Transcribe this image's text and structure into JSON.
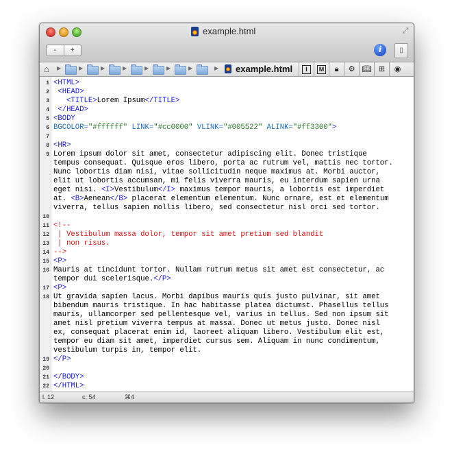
{
  "window": {
    "title": "example.html"
  },
  "toolbar": {
    "zoom_out": "-",
    "zoom_in": "+"
  },
  "pathbar": {
    "file": "example.html",
    "folders": 7
  },
  "tools": [
    "I",
    "M",
    "lock",
    "gear",
    "book",
    "grid",
    "circle"
  ],
  "code": [
    {
      "n": "1",
      "rows": [
        [
          [
            "tag",
            "<HTML>"
          ]
        ]
      ]
    },
    {
      "n": "2",
      "rows": [
        [
          [
            "txt",
            " "
          ],
          [
            "tag",
            "<HEAD>"
          ]
        ]
      ]
    },
    {
      "n": "3",
      "rows": [
        [
          [
            "txt",
            "   "
          ],
          [
            "tag",
            "<TITLE>"
          ],
          [
            "txt",
            "Lorem Ipsum"
          ],
          [
            "tag",
            "</TITLE>"
          ]
        ]
      ]
    },
    {
      "n": "4",
      "rows": [
        [
          [
            "txt",
            " "
          ],
          [
            "tag",
            "</HEAD>"
          ]
        ]
      ]
    },
    {
      "n": "5",
      "rows": [
        [
          [
            "tag",
            "<BODY"
          ]
        ]
      ]
    },
    {
      "n": "6",
      "rows": [
        [
          [
            "attr",
            "BGCOLOR="
          ],
          [
            "str",
            "\"#ffffff\""
          ],
          [
            "txt",
            " "
          ],
          [
            "attr",
            "LINK="
          ],
          [
            "str",
            "\"#cc0000\""
          ],
          [
            "txt",
            " "
          ],
          [
            "attr",
            "VLINK="
          ],
          [
            "str",
            "\"#005522\""
          ],
          [
            "txt",
            " "
          ],
          [
            "attr",
            "ALINK="
          ],
          [
            "str",
            "\"#ff3300\""
          ],
          [
            "tag",
            ">"
          ]
        ]
      ]
    },
    {
      "n": "7",
      "rows": [
        []
      ]
    },
    {
      "n": "8",
      "rows": [
        [
          [
            "tag",
            "<HR>"
          ]
        ]
      ]
    },
    {
      "n": "9",
      "rows": [
        [
          [
            "txt",
            "Lorem ipsum dolor sit amet, consectetur adipiscing elit. Donec tristique"
          ]
        ],
        [
          [
            "txt",
            "tempus consequat. Quisque eros libero, porta ac rutrum vel, mattis nec tortor."
          ]
        ],
        [
          [
            "txt",
            "Nunc lobortis diam nisi, vitae sollicitudin neque maximus at. Morbi auctor,"
          ]
        ],
        [
          [
            "txt",
            "elit ut lobortis accumsan, mi felis viverra mauris, eu interdum sapien urna"
          ]
        ],
        [
          [
            "txt",
            "eget nisi. "
          ],
          [
            "tag",
            "<I>"
          ],
          [
            "txt",
            "Vestibulum"
          ],
          [
            "tag",
            "</I>"
          ],
          [
            "txt",
            " maximus tempor mauris, a lobortis est imperdiet"
          ]
        ],
        [
          [
            "txt",
            "at. "
          ],
          [
            "tag",
            "<B>"
          ],
          [
            "txt",
            "Aenean"
          ],
          [
            "tag",
            "</B>"
          ],
          [
            "txt",
            " placerat elementum elementum. Nunc ornare, est et elementum"
          ]
        ],
        [
          [
            "txt",
            "viverra, tellus sapien mollis libero, sed consectetur nisl orci sed tortor."
          ]
        ]
      ]
    },
    {
      "n": "10",
      "rows": [
        []
      ]
    },
    {
      "n": "11",
      "rows": [
        [
          [
            "com",
            "<!--"
          ]
        ]
      ]
    },
    {
      "n": "12",
      "rows": [
        [
          [
            "com",
            " | Vestibulum massa dolor, tempor sit amet pretium sed blandit"
          ]
        ]
      ]
    },
    {
      "n": "13",
      "rows": [
        [
          [
            "com",
            " | non risus."
          ]
        ]
      ]
    },
    {
      "n": "14",
      "rows": [
        [
          [
            "com",
            "-->"
          ]
        ]
      ]
    },
    {
      "n": "15",
      "rows": [
        [
          [
            "tag",
            "<P>"
          ]
        ]
      ]
    },
    {
      "n": "16",
      "rows": [
        [
          [
            "txt",
            "Mauris at tincidunt tortor. Nullam rutrum metus sit amet est consectetur, ac"
          ]
        ],
        [
          [
            "txt",
            "tempor dui scelerisque."
          ],
          [
            "tag",
            "</P>"
          ]
        ]
      ]
    },
    {
      "n": "17",
      "rows": [
        [
          [
            "tag",
            "<P>"
          ]
        ]
      ]
    },
    {
      "n": "18",
      "rows": [
        [
          [
            "txt",
            "Ut gravida sapien lacus. Morbi dapibus mauris quis justo pulvinar, sit amet"
          ]
        ],
        [
          [
            "txt",
            "bibendum mauris tristique. In hac habitasse platea dictumst. Phasellus tellus"
          ]
        ],
        [
          [
            "txt",
            "mauris, ullamcorper sed pellentesque vel, varius in tellus. Sed non ipsum sit"
          ]
        ],
        [
          [
            "txt",
            "amet nisl pretium viverra tempus at massa. Donec ut metus justo. Donec nisl"
          ]
        ],
        [
          [
            "txt",
            "ex, consequat placerat enim id, laoreet aliquam libero. Vestibulum elit est,"
          ]
        ],
        [
          [
            "txt",
            "tempor eu diam sit amet, imperdiet cursus sem. Aliquam in nunc condimentum,"
          ]
        ],
        [
          [
            "txt",
            "vestibulum turpis in, tempor elit."
          ]
        ]
      ]
    },
    {
      "n": "19",
      "rows": [
        [
          [
            "tag",
            "</P>"
          ]
        ]
      ]
    },
    {
      "n": "20",
      "rows": [
        []
      ]
    },
    {
      "n": "21",
      "rows": [
        [
          [
            "tag",
            "</BODY>"
          ]
        ]
      ]
    },
    {
      "n": "22",
      "rows": [
        [
          [
            "tag",
            "</HTML>"
          ]
        ]
      ]
    }
  ],
  "status": {
    "line": "l. 12",
    "col": "c. 54",
    "shortcut": "⌘4"
  }
}
